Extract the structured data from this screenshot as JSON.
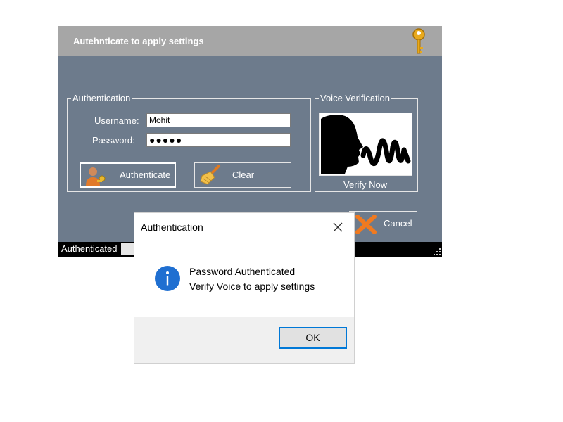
{
  "window": {
    "title": "Autehnticate to apply settings",
    "icon": "key-icon"
  },
  "auth_group": {
    "legend": "Authentication",
    "username_label": "Username:",
    "username_value": "Mohit",
    "password_label": "Password:",
    "password_value": "●●●●●",
    "authenticate_label": "Authenticate",
    "clear_label": "Clear"
  },
  "voice_group": {
    "legend": "Voice Verification",
    "verify_label": "Verify Now",
    "image_icon": "speaking-head-icon"
  },
  "cancel_label": "Cancel",
  "status_bar": {
    "text": "Authenticated"
  },
  "dialog": {
    "title": "Authentication",
    "message_line1": "Password Authenticated",
    "message_line2": "Verify Voice to apply settings",
    "ok_label": "OK",
    "icon": "info-icon"
  },
  "colors": {
    "window_bg": "#6d7b8c",
    "title_bar": "#a6a6a6",
    "status_bar": "#000000",
    "dialog_accent": "#0078d7"
  }
}
